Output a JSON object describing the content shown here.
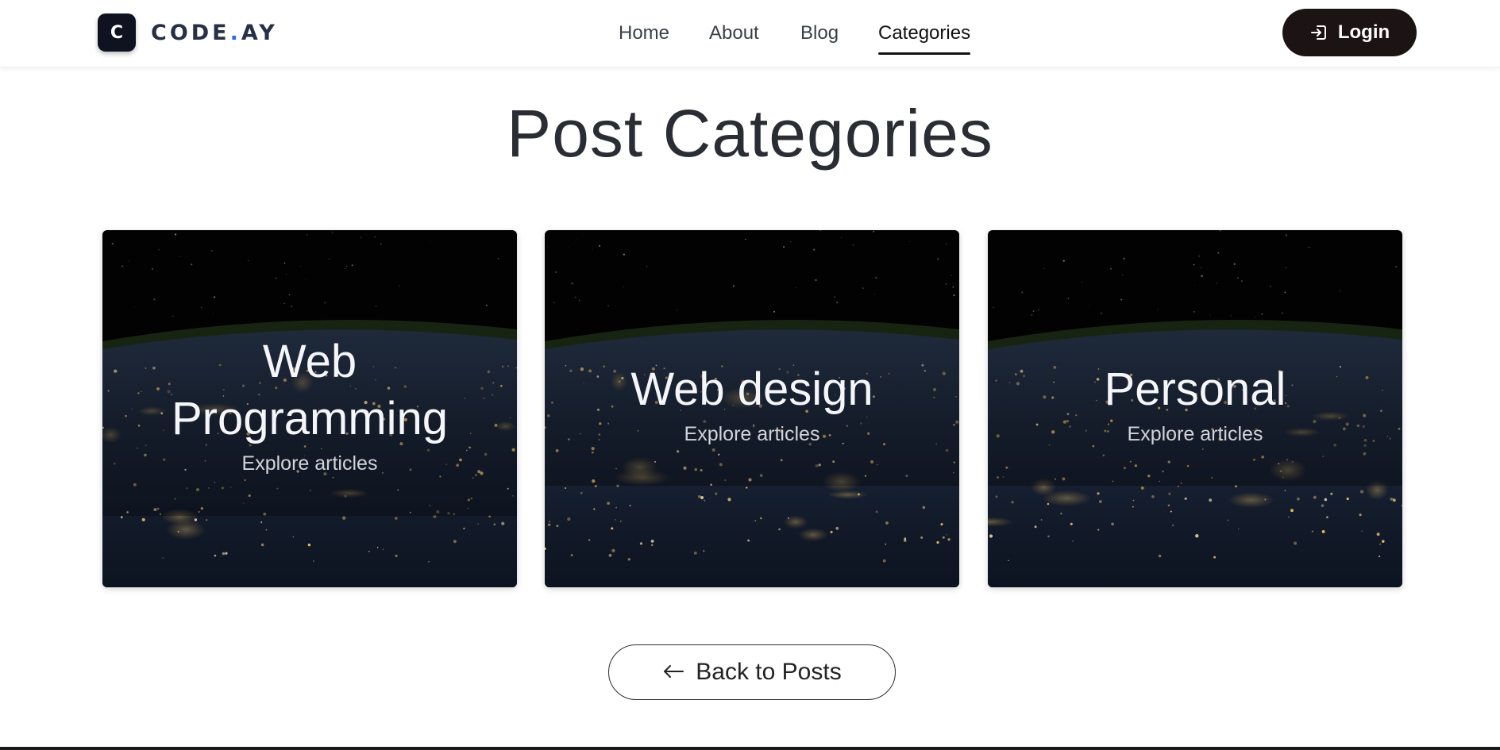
{
  "brand": {
    "logo_letter": "C",
    "name_part1": "CODE",
    "dot": ".",
    "name_part2": "AY"
  },
  "nav": {
    "items": [
      {
        "label": "Home"
      },
      {
        "label": "About"
      },
      {
        "label": "Blog"
      },
      {
        "label": "Categories",
        "active": true
      }
    ],
    "login_label": "Login"
  },
  "page": {
    "title": "Post Categories"
  },
  "categories": [
    {
      "title": "Web Programming",
      "subtitle": "Explore articles"
    },
    {
      "title": "Web design",
      "subtitle": "Explore articles"
    },
    {
      "title": "Personal",
      "subtitle": "Explore articles"
    }
  ],
  "back_button": {
    "label": "Back to Posts",
    "icon": "arrow-left-icon"
  },
  "colors": {
    "accent": "#2d6cdf",
    "dark": "#1c1414",
    "logo_bg": "#0f1220"
  }
}
